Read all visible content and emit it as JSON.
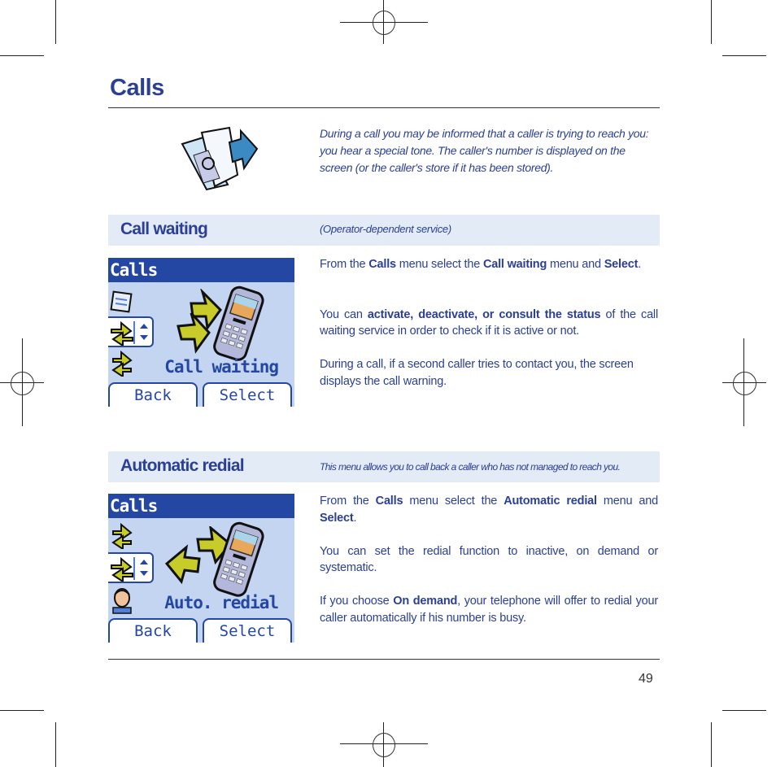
{
  "page": {
    "title": "Calls",
    "intro": "During a call you may be informed that a caller is trying to reach you: you hear a special tone. The caller's number is displayed on the screen (or the  caller's store if it has been stored).",
    "page_number": "49"
  },
  "sections": [
    {
      "title": "Call waiting",
      "note": "(Operator-dependent service)",
      "screen": {
        "header": "Calls",
        "label": "Call waiting",
        "softkey_left": "Back",
        "softkey_right": "Select",
        "icons": [
          "calls-folder-icon",
          "call-waiting-arrows-icon",
          "call-forward-arrows-icon",
          "mobile-phone-icon"
        ]
      },
      "paragraphs": [
        {
          "parts": [
            {
              "t": "From the ",
              "b": false
            },
            {
              "t": "Calls",
              "b": true
            },
            {
              "t": " menu select the ",
              "b": false
            },
            {
              "t": "Call waiting",
              "b": true
            },
            {
              "t": " menu and ",
              "b": false
            },
            {
              "t": "Select",
              "b": true
            },
            {
              "t": ".",
              "b": false
            }
          ]
        },
        {
          "parts": [
            {
              "t": "You can ",
              "b": false
            },
            {
              "t": "activate, deactivate, or consult the status",
              "b": true
            },
            {
              "t": " of the call waiting service in order to check if it is active or not.",
              "b": false
            }
          ]
        },
        {
          "parts": [
            {
              "t": "During a call, if a second caller tries to contact you, the screen displays the call warning.",
              "b": false
            }
          ]
        }
      ]
    },
    {
      "title": "Automatic redial",
      "note": "This menu allows you to call back a caller who has not managed to reach you.",
      "screen": {
        "header": "Calls",
        "label": "Auto. redial",
        "softkey_left": "Back",
        "softkey_right": "Select",
        "icons": [
          "call-waiting-arrows-icon",
          "call-forward-arrows-icon",
          "operator-headset-icon",
          "mobile-phone-icon"
        ]
      },
      "paragraphs": [
        {
          "parts": [
            {
              "t": "From the ",
              "b": false
            },
            {
              "t": "Calls",
              "b": true
            },
            {
              "t": " menu select the ",
              "b": false
            },
            {
              "t": "Automatic redial",
              "b": true
            },
            {
              "t": " menu and ",
              "b": false
            },
            {
              "t": "Select",
              "b": true
            },
            {
              "t": ".",
              "b": false
            }
          ]
        },
        {
          "parts": [
            {
              "t": "You can set the redial function to inactive, on demand or systematic.",
              "b": false
            }
          ]
        },
        {
          "parts": [
            {
              "t": "If you choose ",
              "b": false
            },
            {
              "t": "On demand",
              "b": true
            },
            {
              "t": ", your telephone will offer to redial your caller automatically if his number is busy.",
              "b": false
            }
          ]
        }
      ]
    }
  ],
  "colors": {
    "brand_blue": "#2b3f96",
    "screen_header": "#2447a4",
    "screen_bg": "#c3d5f0",
    "band_bg": "#e3ebf7",
    "arrow_yellow": "#c8cc2a"
  }
}
